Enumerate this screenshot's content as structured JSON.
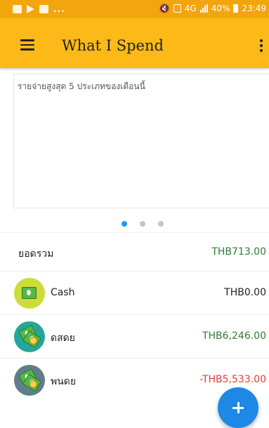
{
  "status_bar": {
    "dots": "...",
    "network": "4G",
    "battery": "40%",
    "time": "23:49"
  },
  "app_bar": {
    "title": "What I Spend",
    "menu_icon": "hamburger-menu-icon",
    "overflow_icon": "more-vert-icon"
  },
  "chart_card": {
    "title": "รายจ่ายสูงสุด 5 ประเภทของเดือนนี้"
  },
  "pager": {
    "page_count": 3,
    "active_page": 1
  },
  "summary": {
    "label": "ยอดรวม",
    "amount": "THB713.00"
  },
  "accounts": [
    {
      "name": "Cash",
      "amount": "THB0.00",
      "icon": "cash-icon"
    },
    {
      "name": "ดสดย",
      "amount": "THB6,246.00",
      "icon": "money-icon"
    },
    {
      "name": "พนดย",
      "amount": "-THB5,533.00",
      "icon": "money-icon"
    }
  ],
  "fab": {
    "icon": "plus-icon"
  },
  "colors": {
    "status_bar": "#f2a50d",
    "app_bar": "#fcb917",
    "positive": "#2e7d32",
    "negative": "#e53935",
    "neutral": "#212121",
    "accent": "#1e88e5",
    "avatar_cash": "#cddc39",
    "avatar_teal": "#26a69a",
    "avatar_slate": "#607d8b"
  }
}
